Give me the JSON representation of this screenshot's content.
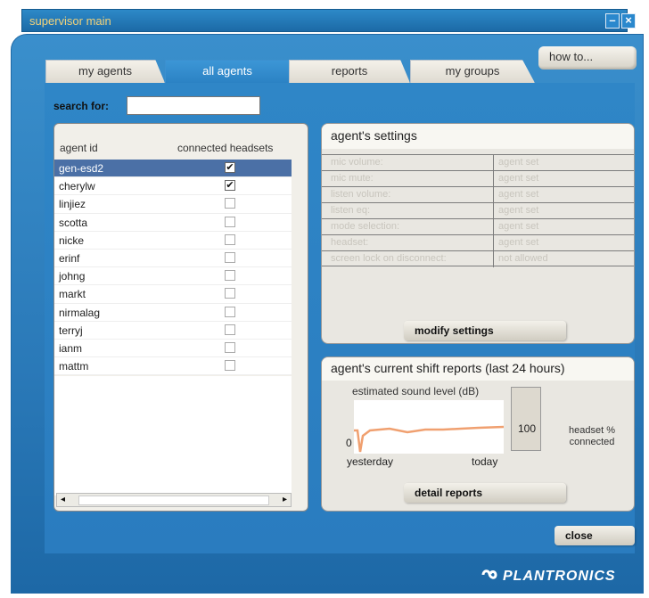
{
  "window": {
    "title": "supervisor main",
    "minimize": "–",
    "close": "×"
  },
  "tabs": [
    {
      "label": "my agents"
    },
    {
      "label": "all agents"
    },
    {
      "label": "reports"
    },
    {
      "label": "my groups"
    }
  ],
  "active_tab": "all agents",
  "howto_label": "how to...",
  "search": {
    "label": "search for:",
    "value": "",
    "placeholder": ""
  },
  "agents": {
    "columns": [
      "agent id",
      "connected headsets"
    ],
    "rows": [
      {
        "id": "gen-esd2",
        "connected": true,
        "selected": true
      },
      {
        "id": "cherylw",
        "connected": true
      },
      {
        "id": "linjiez",
        "connected": false
      },
      {
        "id": "scotta",
        "connected": false
      },
      {
        "id": "nicke",
        "connected": false
      },
      {
        "id": "erinf",
        "connected": false
      },
      {
        "id": "johng",
        "connected": false
      },
      {
        "id": "markt",
        "connected": false
      },
      {
        "id": "nirmalag",
        "connected": false
      },
      {
        "id": "terryj",
        "connected": false
      },
      {
        "id": "ianm",
        "connected": false
      },
      {
        "id": "mattm",
        "connected": false
      }
    ],
    "scroll_left": "◂",
    "scroll_right": "▸"
  },
  "settings": {
    "title": "agent's settings",
    "rows": [
      {
        "key": "mic volume:",
        "value": "agent set"
      },
      {
        "key": "mic mute:",
        "value": "agent set"
      },
      {
        "key": "listen volume:",
        "value": "agent set"
      },
      {
        "key": "listen eq:",
        "value": "agent set"
      },
      {
        "key": "mode selection:",
        "value": "agent set"
      },
      {
        "key": "headset:",
        "value": "agent set"
      },
      {
        "key": "screen lock on disconnect:",
        "value": "not allowed"
      }
    ],
    "modify_label": "modify settings"
  },
  "reports": {
    "title": "agent's current shift reports (last 24 hours)",
    "graph_title": "estimated sound level (dB)",
    "y_min_label": "0",
    "x_start": "yesterday",
    "x_end": "today",
    "line_color": "#f0a070",
    "headset_percent": "100",
    "headset_label": "headset % connected",
    "detail_label": "detail reports"
  },
  "close_label": "close",
  "brand": "PLANTRONICS"
}
